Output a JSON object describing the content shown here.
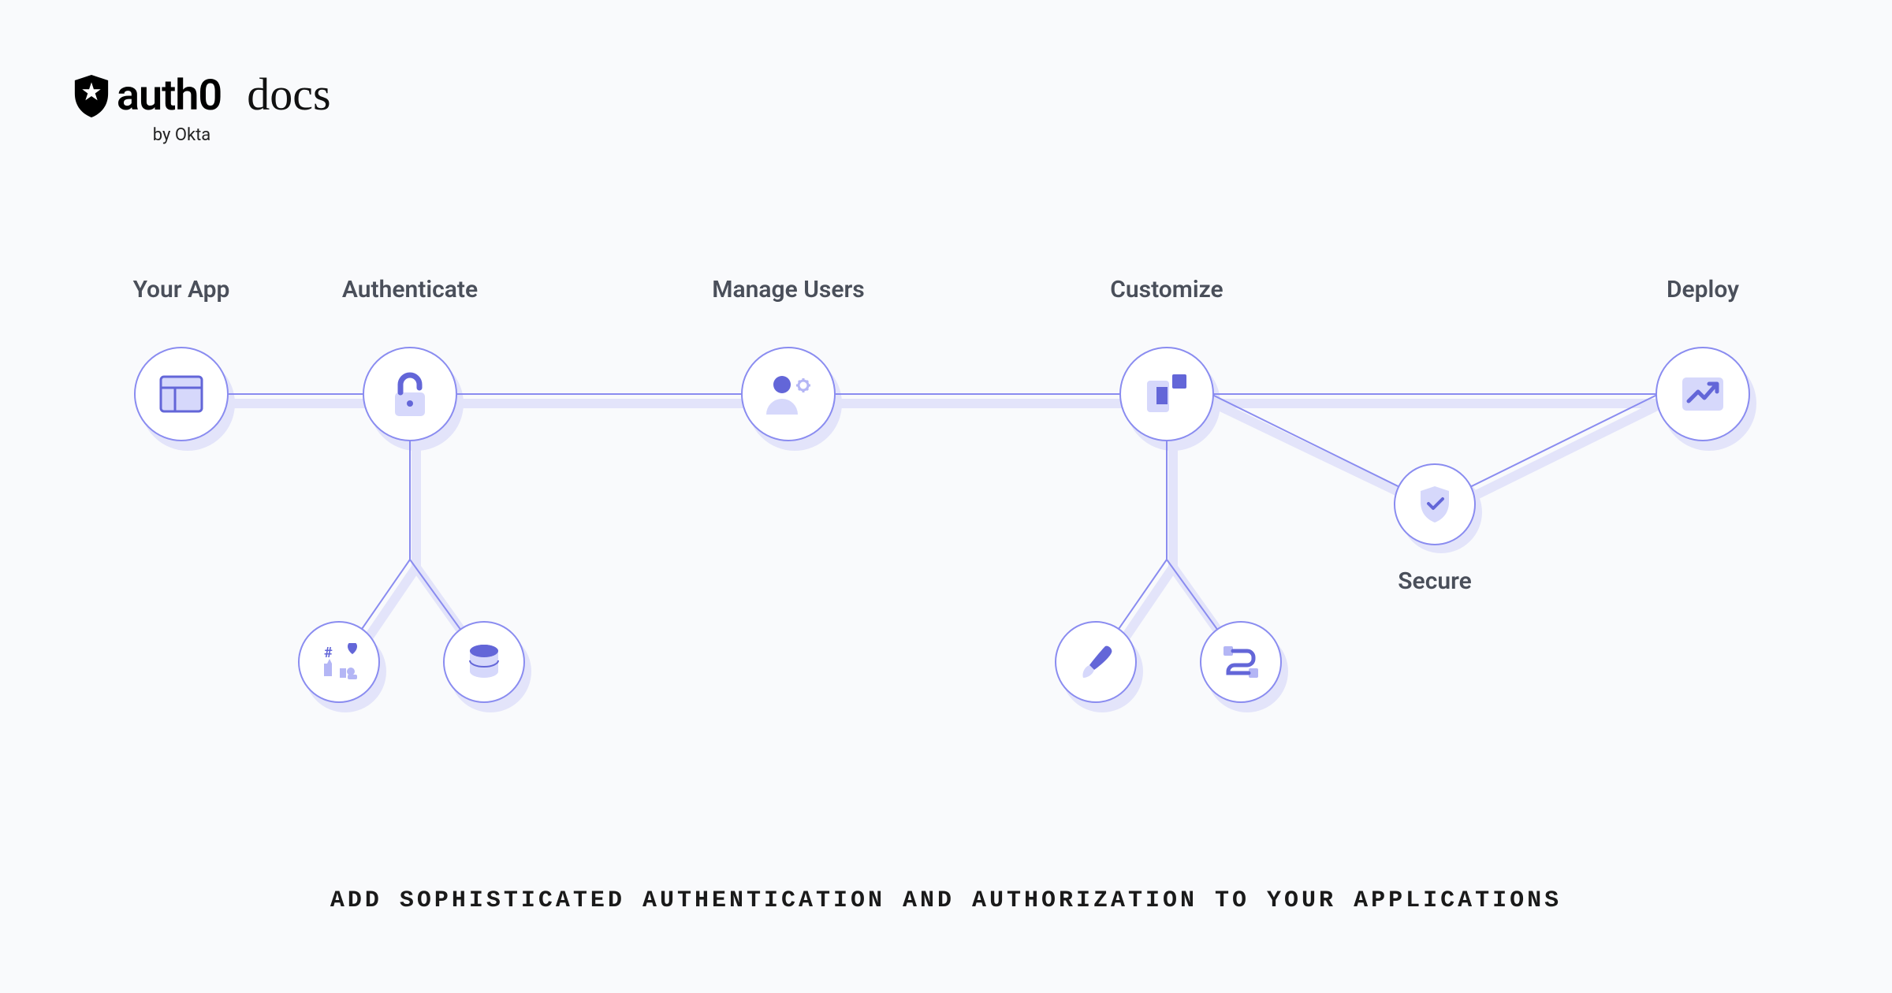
{
  "brand": {
    "name": "auth0",
    "byline": "by Okta",
    "section": "docs"
  },
  "nodes": {
    "your_app": "Your App",
    "authenticate": "Authenticate",
    "manage_users": "Manage Users",
    "customize": "Customize",
    "deploy": "Deploy",
    "secure": "Secure"
  },
  "tagline": "ADD SOPHISTICATED AUTHENTICATION AND AUTHORIZATION TO YOUR APPLICATIONS",
  "colors": {
    "node_border": "#8a8cf0",
    "icon_primary": "#6366d8",
    "icon_light": "#c7c9f7",
    "shadow": "#e3e4fa",
    "bg": "#f9fafc",
    "text": "#4a4f5a"
  }
}
